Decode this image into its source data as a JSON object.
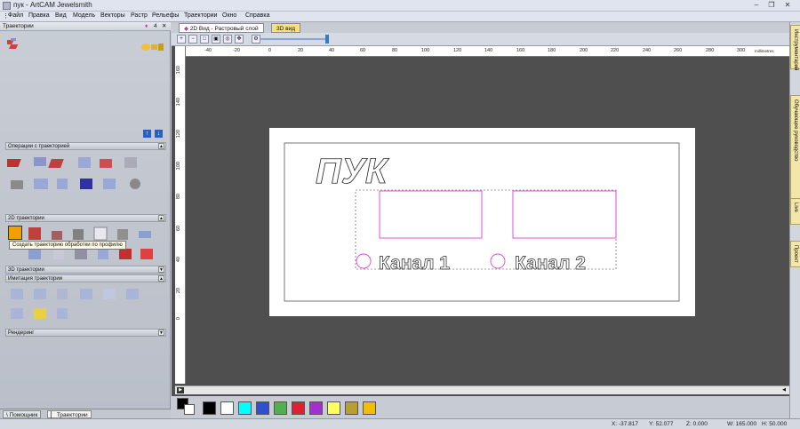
{
  "window": {
    "title": "пук - ArtCAM Jewelsmith"
  },
  "menu": [
    "Файл",
    "Правка",
    "Вид",
    "Модель",
    "Векторы",
    "Растр",
    "Рельефы",
    "Траектории",
    "Окно",
    "Справка"
  ],
  "left_panel": {
    "title": "Траектории",
    "pin": "4",
    "sections": {
      "ops": "Операции с траекторией",
      "twod": "2D траектории",
      "threed": "3D траектории",
      "sim": "Имитация траектории",
      "render": "Рендеринг"
    },
    "tooltip": "Создать траекторию обработки по профилю",
    "bottom_tabs": [
      "Помощник",
      "Траектории"
    ]
  },
  "doc_tabs": [
    "2D Вид - Растровый слой",
    "3D вид"
  ],
  "ruler": {
    "h_labels": [
      "-40",
      "-20",
      "0",
      "20",
      "40",
      "60",
      "80",
      "100",
      "120",
      "140",
      "160",
      "180",
      "200",
      "220",
      "240",
      "260",
      "280",
      "300"
    ],
    "unit": "millimetres",
    "v_labels": [
      "160",
      "140",
      "120",
      "100",
      "80",
      "60",
      "40",
      "20",
      "0"
    ]
  },
  "canvas": {
    "big_text": "ПУК",
    "channel1": "Канал 1",
    "channel2": "Канал 2"
  },
  "palette": [
    "#000000",
    "#ffffff",
    "#00ffff",
    "#3050d0",
    "#50b050",
    "#e02030",
    "#a030d0",
    "#ffff60",
    "#b8a030",
    "#f0c000"
  ],
  "right_tabs": [
    "Инструментарий",
    "Обучающее руководство",
    "Live",
    "Проект"
  ],
  "status": {
    "x": "X: -37.817",
    "y": "Y: 52.077",
    "z": "Z: 0.000",
    "w": "W: 165.000",
    "h": "H: 50.000"
  },
  "colors": {
    "accent": "#3a78d0",
    "vector_select": "#e040e0"
  }
}
